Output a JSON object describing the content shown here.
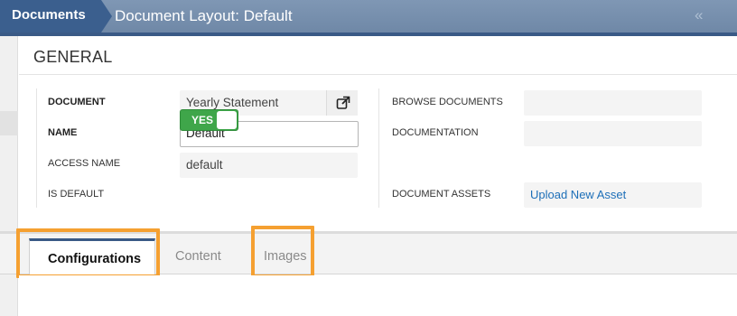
{
  "header": {
    "breadcrumb": "Documents",
    "title": "Document Layout: Default",
    "collapse_icon": "«"
  },
  "section": {
    "title": "GENERAL"
  },
  "form": {
    "document_label": "DOCUMENT",
    "document_value": "Yearly Statement",
    "name_label": "NAME",
    "name_value": "Default",
    "access_name_label": "ACCESS NAME",
    "access_name_value": "default",
    "is_default_label": "IS DEFAULT",
    "is_default_value": "YES",
    "browse_documents_label": "BROWSE DOCUMENTS",
    "browse_documents_value": "",
    "documentation_label": "DOCUMENTATION",
    "documentation_value": "",
    "document_assets_label": "DOCUMENT ASSETS",
    "upload_link": "Upload New Asset"
  },
  "tabs": [
    {
      "label": "Configurations",
      "active": true
    },
    {
      "label": "Content",
      "active": false
    },
    {
      "label": "Images",
      "active": false
    }
  ],
  "colors": {
    "header": "#7590ae",
    "accent": "#3a5a86",
    "toggle_on": "#3fa64a",
    "link": "#1d6fb8",
    "highlight": "#f5a031"
  }
}
